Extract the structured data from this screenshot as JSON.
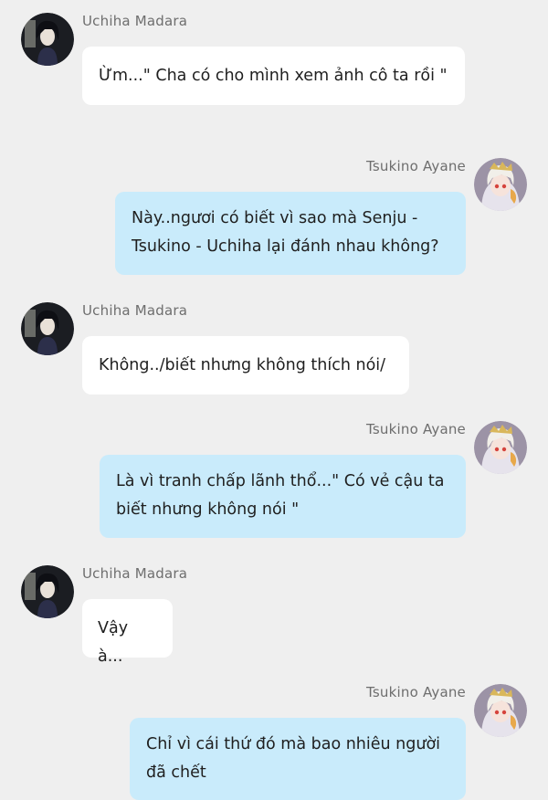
{
  "chat": {
    "messages": [
      {
        "sender": "Uchiha Madara",
        "side": "left",
        "avatar": "madara-avatar-icon",
        "text": "Ừm...\" Cha có cho mình xem ảnh cô ta rồi \""
      },
      {
        "sender": "Tsukino Ayane",
        "side": "right",
        "avatar": "ayane-avatar-icon",
        "text": "Này..ngươi có biết vì sao mà Senju - Tsukino - Uchiha lại đánh nhau không?"
      },
      {
        "sender": "Uchiha Madara",
        "side": "left",
        "avatar": "madara-avatar-icon",
        "text": "Không../biết nhưng không thích nói/"
      },
      {
        "sender": "Tsukino Ayane",
        "side": "right",
        "avatar": "ayane-avatar-icon",
        "text": "Là vì tranh chấp lãnh thổ...\" Có vẻ cậu ta biết nhưng không nói \""
      },
      {
        "sender": "Uchiha Madara",
        "side": "left",
        "avatar": "madara-avatar-icon",
        "text": "Vậy à..."
      },
      {
        "sender": "Tsukino Ayane",
        "side": "right",
        "avatar": "ayane-avatar-icon",
        "text": "Chỉ vì cái thứ đó mà bao nhiêu người đã chết"
      }
    ]
  },
  "colors": {
    "background": "#efefef",
    "left_bubble": "#ffffff",
    "right_bubble": "#c9ebfb",
    "name_text": "#6e6e6e",
    "message_text": "#1f1f1f"
  }
}
